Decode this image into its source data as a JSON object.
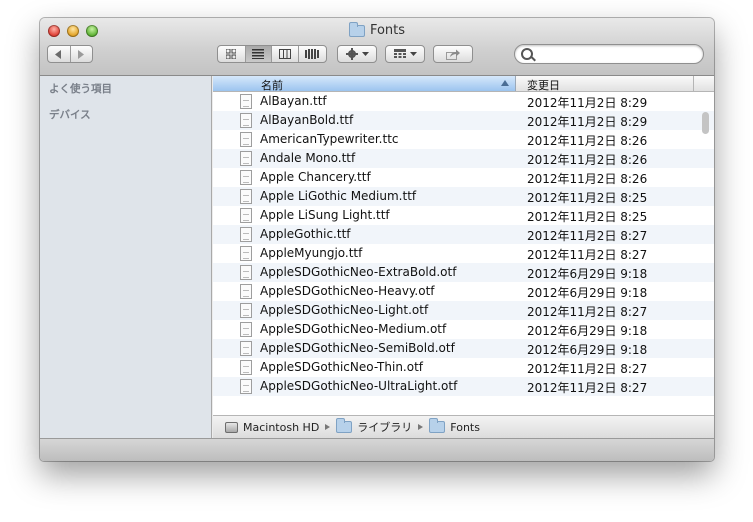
{
  "window": {
    "title": "Fonts"
  },
  "toolbar": {
    "back_icon": "chevron-left-icon",
    "forward_icon": "chevron-right-icon",
    "view_modes": [
      "icon-view-icon",
      "list-view-icon",
      "column-view-icon",
      "coverflow-view-icon"
    ],
    "active_view": "list-view-icon",
    "action_icon": "gear-icon",
    "arrange_icon": "grid-arrange-icon",
    "share_icon": "share-icon",
    "search": {
      "value": "",
      "placeholder": ""
    }
  },
  "sidebar": {
    "favorites_heading": "よく使う項目",
    "devices_heading": "デバイス"
  },
  "columns": {
    "name": "名前",
    "date": "変更日"
  },
  "files": [
    {
      "name": "AlBayan.ttf",
      "date": "2012年11月2日 8:29"
    },
    {
      "name": "AlBayanBold.ttf",
      "date": "2012年11月2日 8:29"
    },
    {
      "name": "AmericanTypewriter.ttc",
      "date": "2012年11月2日 8:26"
    },
    {
      "name": "Andale Mono.ttf",
      "date": "2012年11月2日 8:26"
    },
    {
      "name": "Apple Chancery.ttf",
      "date": "2012年11月2日 8:26"
    },
    {
      "name": "Apple LiGothic Medium.ttf",
      "date": "2012年11月2日 8:25"
    },
    {
      "name": "Apple LiSung Light.ttf",
      "date": "2012年11月2日 8:25"
    },
    {
      "name": "AppleGothic.ttf",
      "date": "2012年11月2日 8:27"
    },
    {
      "name": "AppleMyungjo.ttf",
      "date": "2012年11月2日 8:27"
    },
    {
      "name": "AppleSDGothicNeo-ExtraBold.otf",
      "date": "2012年6月29日 9:18"
    },
    {
      "name": "AppleSDGothicNeo-Heavy.otf",
      "date": "2012年6月29日 9:18"
    },
    {
      "name": "AppleSDGothicNeo-Light.otf",
      "date": "2012年11月2日 8:27"
    },
    {
      "name": "AppleSDGothicNeo-Medium.otf",
      "date": "2012年6月29日 9:18"
    },
    {
      "name": "AppleSDGothicNeo-SemiBold.otf",
      "date": "2012年6月29日 9:18"
    },
    {
      "name": "AppleSDGothicNeo-Thin.otf",
      "date": "2012年11月2日 8:27"
    },
    {
      "name": "AppleSDGothicNeo-UltraLight.otf",
      "date": "2012年11月2日 8:27"
    }
  ],
  "pathbar": {
    "items": [
      {
        "label": "Macintosh HD",
        "icon": "hard-drive-icon"
      },
      {
        "label": "ライブラリ",
        "icon": "library-folder-icon"
      },
      {
        "label": "Fonts",
        "icon": "folder-icon"
      }
    ]
  }
}
